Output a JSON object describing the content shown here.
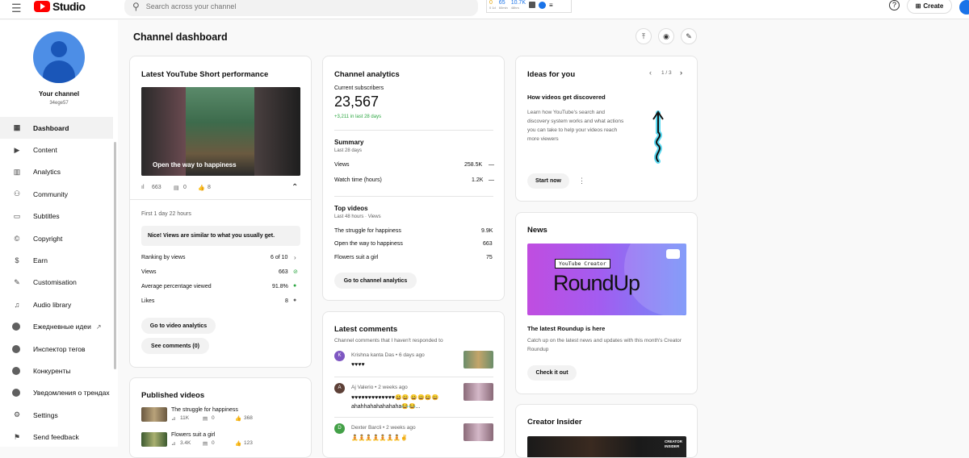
{
  "app": {
    "logo_text": "Studio"
  },
  "search": {
    "placeholder": "Search across your channel"
  },
  "widget": {
    "n1": "0",
    "n1_sub": "0 1d",
    "n2": "65",
    "n2_sub": "60min",
    "n3": "10.7K",
    "n3_sub": "48hrs"
  },
  "topbar": {
    "create_label": "Create"
  },
  "sidebar": {
    "channel_label": "Your channel",
    "channel_id": "34ege57",
    "items": [
      {
        "label": "Dashboard",
        "icon": "dashboard-icon"
      },
      {
        "label": "Content",
        "icon": "content-icon"
      },
      {
        "label": "Analytics",
        "icon": "analytics-icon"
      },
      {
        "label": "Community",
        "icon": "community-icon"
      },
      {
        "label": "Subtitles",
        "icon": "subtitles-icon"
      },
      {
        "label": "Copyright",
        "icon": "copyright-icon"
      },
      {
        "label": "Earn",
        "icon": "earn-icon"
      },
      {
        "label": "Customisation",
        "icon": "customisation-icon"
      },
      {
        "label": "Audio library",
        "icon": "audio-library-icon"
      },
      {
        "label": "Ежедневные идеи",
        "icon": "extension-icon"
      },
      {
        "label": "Инспектор тегов",
        "icon": "extension-icon"
      },
      {
        "label": "Конкуренты",
        "icon": "extension-icon"
      },
      {
        "label": "Уведомления о трендах",
        "icon": "extension-icon"
      },
      {
        "label": "Settings",
        "icon": "settings-icon"
      },
      {
        "label": "Send feedback",
        "icon": "feedback-icon"
      }
    ]
  },
  "main": {
    "title": "Channel dashboard"
  },
  "short_card": {
    "title": "Latest YouTube Short performance",
    "thumb_caption": "Open the way to happiness",
    "views": "663",
    "comments": "0",
    "likes": "8",
    "period": "First 1 day 22 hours",
    "insight": "Nice! Views are similar to what you usually get.",
    "rows": [
      {
        "label": "Ranking by views",
        "value": "6 of 10"
      },
      {
        "label": "Views",
        "value": "663"
      },
      {
        "label": "Average percentage viewed",
        "value": "91.8%"
      },
      {
        "label": "Likes",
        "value": "8"
      }
    ],
    "btn_analytics": "Go to video analytics",
    "btn_comments": "See comments (0)"
  },
  "analytics_card": {
    "title": "Channel analytics",
    "subs_label": "Current subscribers",
    "subs_value": "23,567",
    "subs_change": "+3,211 in last 28 days",
    "summary_title": "Summary",
    "summary_period": "Last 28 days",
    "summary_rows": [
      {
        "label": "Views",
        "value": "258.5K",
        "trend": "—"
      },
      {
        "label": "Watch time (hours)",
        "value": "1.2K",
        "trend": "—"
      }
    ],
    "top_title": "Top videos",
    "top_period": "Last 48 hours · Views",
    "top_rows": [
      {
        "label": "The struggle for happiness",
        "value": "9.9K"
      },
      {
        "label": "Open the way to happiness",
        "value": "663"
      },
      {
        "label": "Flowers suit a girl",
        "value": "75"
      }
    ],
    "btn": "Go to channel analytics"
  },
  "ideas_card": {
    "title": "Ideas for you",
    "pager": "1 / 3",
    "subtitle": "How videos get discovered",
    "body": "Learn how YouTube's search and discovery system works and what actions you can take to help your videos reach more viewers",
    "btn": "Start now"
  },
  "news_card": {
    "title": "News",
    "banner_small": "YouTube Creator",
    "banner_big": "RoundUp",
    "headline": "The latest Roundup is here",
    "body": "Catch up on the latest news and updates with this month's Creator Roundup",
    "btn": "Check it out"
  },
  "insider_card": {
    "title": "Creator Insider",
    "thumb_text": "CREATOR INSIDER"
  },
  "published_card": {
    "title": "Published videos",
    "videos": [
      {
        "title": "The struggle for happiness",
        "views": "11K",
        "comments": "0",
        "likes": "368"
      },
      {
        "title": "Flowers suit a girl",
        "views": "3.4K",
        "comments": "0",
        "likes": "123"
      }
    ]
  },
  "comments_card": {
    "title": "Latest comments",
    "subtitle": "Channel comments that I haven't responded to",
    "items": [
      {
        "initial": "K",
        "author": "Krishna kanta Das • 6 days ago",
        "text": "♥♥♥♥",
        "color": "#7e57c2"
      },
      {
        "initial": "A",
        "author": "Aj Valerio • 2 weeks ago",
        "text": "♥♥♥♥♥♥♥♥♥♥♥♥♥😀😀 😀😀😀😀 ahahhahahahahaha😂😂...",
        "color": "#5d4037"
      },
      {
        "initial": "D",
        "author": "Dexter Barcli • 2 weeks ago",
        "text": "🧘🧘🧘🧘🧘🧘🧘✌",
        "color": "#43a047"
      }
    ]
  }
}
